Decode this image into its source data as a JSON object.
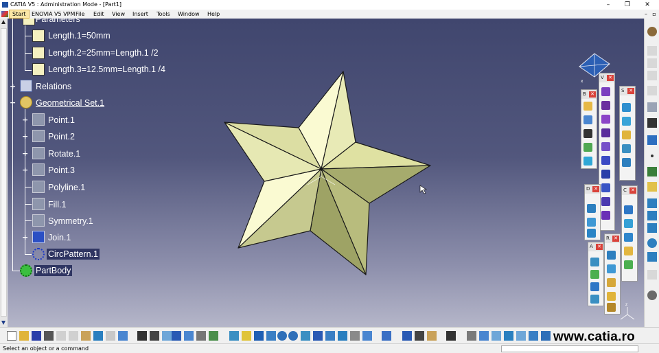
{
  "window": {
    "title": "CATIA V5 : Administration Mode - [Part1]",
    "controls": [
      "–",
      "❐",
      "✕"
    ]
  },
  "menubar": {
    "start": "Start",
    "items": [
      "ENOVIA V5 VPM",
      "File",
      "Edit",
      "View",
      "Insert",
      "Tools",
      "Window",
      "Help"
    ],
    "doc_controls": [
      "–",
      "▫",
      "✕"
    ]
  },
  "tree": {
    "partial_node": "Parameters",
    "parameters": [
      "Length.1=50mm",
      "Length.2=25mm=Length.1 /2",
      "Length.3=12.5mm=Length.1 /4"
    ],
    "relations": "Relations",
    "geometrical_set": "Geometrical Set.1",
    "features": [
      {
        "label": "Point.1",
        "expandable": true
      },
      {
        "label": "Point.2",
        "expandable": true
      },
      {
        "label": "Rotate.1",
        "expandable": true
      },
      {
        "label": "Point.3",
        "expandable": true
      },
      {
        "label": "Polyline.1",
        "expandable": false
      },
      {
        "label": "Fill.1",
        "expandable": false
      },
      {
        "label": "Symmetry.1",
        "expandable": false
      },
      {
        "label": "Join.1",
        "expandable": true
      },
      {
        "label": "CircPattern.1",
        "expandable": false
      }
    ],
    "part_body": "PartBody"
  },
  "viewport": {
    "compass_axes": {
      "x": "x",
      "y": "y",
      "z": "z"
    },
    "colors": {
      "star_light": "#fafad2",
      "star_mid": "#dfe1a2",
      "star_dark": "#a6ab6d",
      "background_top": "#40466e",
      "background_bottom": "#b5b6c9"
    }
  },
  "floating_toolbars": [
    {
      "letter": "B",
      "close": "✕"
    },
    {
      "letter": "V",
      "close": "✕"
    },
    {
      "letter": "S",
      "close": "✕"
    },
    {
      "letter": "D",
      "close": "✕"
    },
    {
      "letter": "C",
      "close": "✕"
    },
    {
      "letter": "R",
      "close": "✕"
    },
    {
      "letter": "A",
      "close": "✕"
    }
  ],
  "statusbar": {
    "message": "Select an object or a command",
    "watermark": "www.catia.ro"
  }
}
